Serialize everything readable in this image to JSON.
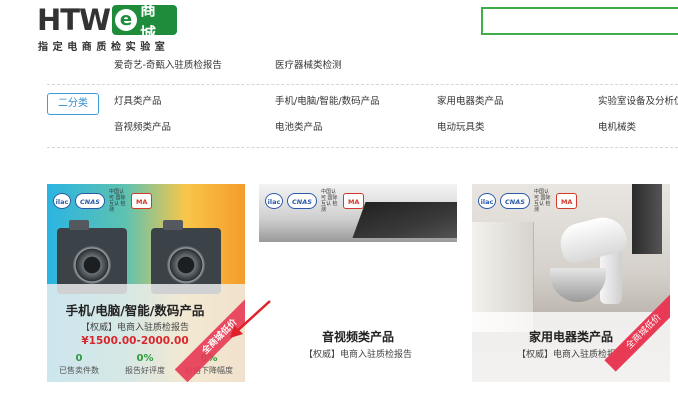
{
  "header": {
    "logo_letters": "HTW",
    "logo_e": "e",
    "logo_mall": "商城",
    "logo_subtitle": "指定电商质检实验室",
    "search_placeholder": ""
  },
  "categories": {
    "top_row": [
      "爱奇艺-奇甄入驻质检报告",
      "医疗器械类检测"
    ],
    "secondary_label": "二分类",
    "row1": [
      "灯具类产品",
      "手机/电脑/智能/数码产品",
      "家用电器类产品",
      "实验室设备及分析仪器"
    ],
    "row2": [
      "音视频类产品",
      "电池类产品",
      "电动玩具类",
      "电机械类"
    ]
  },
  "cards": [
    {
      "title": "手机/电脑/智能/数码产品",
      "subtitle": "【权威】电商入驻质检报告",
      "price": "¥1500.00-2000.00",
      "stats": [
        {
          "value": "0",
          "label": "已售卖件数"
        },
        {
          "value": "0%",
          "label": "报告好评度"
        },
        {
          "value": "0%",
          "label": "价格下降幅度"
        }
      ],
      "ribbon": "全商城低价"
    },
    {
      "title": "音视频类产品",
      "subtitle": "【权威】电商入驻质检报告"
    },
    {
      "title": "家用电器类产品",
      "subtitle": "【权威】电商入驻质检报告",
      "ribbon": "全商城低价"
    }
  ],
  "certs": {
    "ilac": "ilac",
    "cnas": "CNAS",
    "cnas_text": "中国认可 国际互认 检测",
    "cma": "MA"
  },
  "colors": {
    "brand_green": "#1e8c3a",
    "search_border": "#3fae49",
    "price_red": "#d9272d",
    "stat_green": "#2e9b3e",
    "button_blue": "#3aa0d8",
    "ribbon_red": "#e83a55"
  }
}
